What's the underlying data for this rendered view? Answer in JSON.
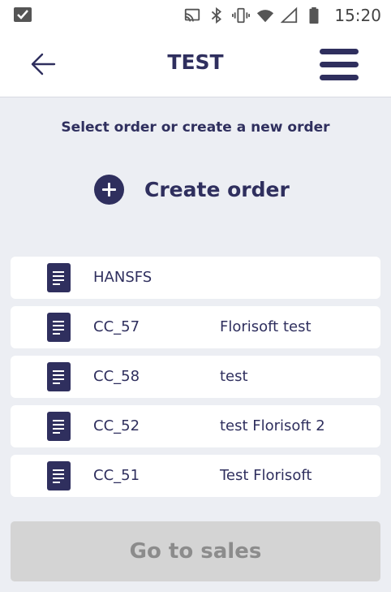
{
  "status_bar": {
    "time": "15:20",
    "icons": [
      "checkbox-notification-icon",
      "cast-icon",
      "bluetooth-icon",
      "vibrate-icon",
      "wifi-icon",
      "signal-icon",
      "battery-icon"
    ]
  },
  "app_bar": {
    "title": "TEST",
    "back_icon": "arrow-left-icon",
    "menu_icon": "hamburger-menu-icon"
  },
  "main": {
    "subtitle": "Select order or create a new order",
    "create_order_label": "Create order",
    "create_order_icon": "plus-circle-icon",
    "orders": [
      {
        "code": "HANSFS",
        "name": ""
      },
      {
        "code": "CC_57",
        "name": "Florisoft test"
      },
      {
        "code": "CC_58",
        "name": "test"
      },
      {
        "code": "CC_52",
        "name": "test Florisoft 2"
      },
      {
        "code": "CC_51",
        "name": "Test Florisoft"
      }
    ]
  },
  "footer": {
    "go_to_sales_label": "Go to sales",
    "go_to_sales_enabled": false
  },
  "colors": {
    "primary": "#2f2f5e",
    "background": "#eceef3",
    "card": "#ffffff",
    "disabled_button": "#d4d4d4",
    "disabled_text": "#8c8c8c"
  }
}
